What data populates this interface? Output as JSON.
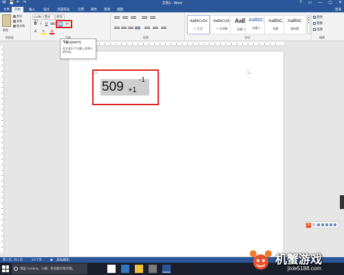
{
  "titlebar": {
    "title": "文档1 - Word",
    "qat": [
      "W",
      "💾",
      "↶",
      "↷"
    ],
    "controls": [
      "?",
      "▭",
      "—",
      "▢",
      "✕"
    ]
  },
  "tabs": {
    "items": [
      "文件",
      "开始",
      "插入",
      "设计",
      "页面布局",
      "引用",
      "邮件",
      "审阅",
      "视图"
    ],
    "active_index": 1,
    "signin": "登录"
  },
  "clipboard": {
    "paste": "粘贴",
    "cut": "剪切",
    "copy": "复制",
    "painter": "格式刷",
    "group": "剪贴板"
  },
  "font": {
    "name": "Calibri (西文正)",
    "size": "初号",
    "group": "字体"
  },
  "paragraph": {
    "group": "段落"
  },
  "styles": {
    "group": "样式",
    "items": [
      {
        "sample": "AaBbCcDd",
        "name": "↵ 正文"
      },
      {
        "sample": "AaBbCcDd",
        "name": "↵ 无间隔"
      },
      {
        "sample": "AaBl",
        "name": "标题 1"
      },
      {
        "sample": "AaBbC",
        "name": "标题 2"
      },
      {
        "sample": "AaBbC",
        "name": "标题"
      },
      {
        "sample": "AaBbC",
        "name": "副标题"
      }
    ]
  },
  "editing": {
    "find": "查找",
    "replace": "替换",
    "select": "选择",
    "group": "编辑"
  },
  "tooltip": {
    "title": "下标 (Ctrl+=)",
    "body": "在文本行下方键入非常小的字母。"
  },
  "document": {
    "base": "509",
    "subscript": "+1",
    "superscript": "-1"
  },
  "ime": {
    "label": "中"
  },
  "statusbar": {
    "page": "第 1 页，共 1 页",
    "words": "3/3 个字",
    "lang": "英语(美国)"
  },
  "taskbar": {
    "search": "我是 Cortana，小娜。有问题尽管问我。"
  },
  "watermark": {
    "brand": "机蟹游戏",
    "url": "jixie5188.com"
  },
  "colors": {
    "word_blue": "#2b579a",
    "annotation_red": "#dd2222",
    "selection_gray": "#cfcfcf"
  }
}
